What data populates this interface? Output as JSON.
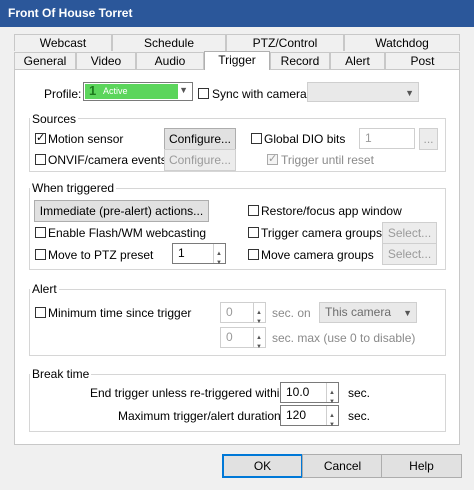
{
  "window": {
    "title": "Front Of House Torret"
  },
  "tabs_row1": [
    "Webcast",
    "Schedule",
    "PTZ/Control",
    "Watchdog"
  ],
  "tabs_row2": [
    "General",
    "Video",
    "Audio",
    "Trigger",
    "Record",
    "Alert",
    "Post"
  ],
  "active_tab": "Trigger",
  "profile": {
    "label": "Profile:",
    "value": "Active",
    "badge": "1",
    "sync_label": "Sync with camera"
  },
  "sources": {
    "title": "Sources",
    "motion_sensor": "Motion sensor",
    "configure": "Configure...",
    "global_dio": "Global DIO bits",
    "dio_value": "1",
    "dio_button": "...",
    "onvif": "ONVIF/camera events",
    "configure2": "Configure...",
    "trigger_until_reset": "Trigger until reset"
  },
  "when_triggered": {
    "title": "When triggered",
    "immediate_button": "Immediate (pre-alert) actions...",
    "restore_focus": "Restore/focus app window",
    "enable_flash": "Enable Flash/WM webcasting",
    "trigger_groups": "Trigger camera groups",
    "select1": "Select...",
    "move_ptz": "Move to PTZ preset",
    "ptz_value": "1",
    "move_groups": "Move camera groups",
    "select2": "Select..."
  },
  "alert": {
    "title": "Alert",
    "min_time": "Minimum time since trigger",
    "val1": "0",
    "unit1": "sec. on",
    "camera": "This camera",
    "val2": "0",
    "unit2": "sec. max (use 0 to disable)"
  },
  "break_time": {
    "title": "Break time",
    "end_trigger": "End trigger unless re-triggered within",
    "end_value": "10.0",
    "end_unit": "sec.",
    "max_duration": "Maximum trigger/alert duration",
    "max_value": "120",
    "max_unit": "sec."
  },
  "footer": {
    "ok": "OK",
    "cancel": "Cancel",
    "help": "Help"
  },
  "colors": {
    "title_bar": "#2b579a",
    "profile_green": "#5bd55b",
    "ok_border": "#0078d7"
  }
}
